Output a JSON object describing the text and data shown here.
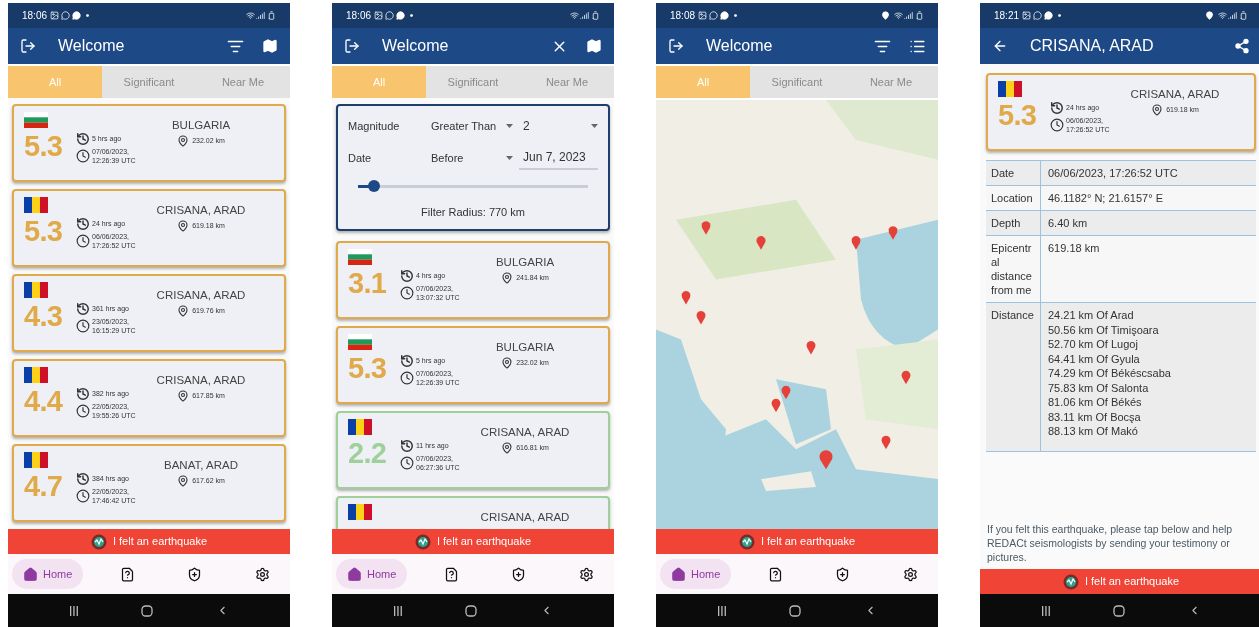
{
  "screens": [
    {
      "kind": "list",
      "status_bar": {
        "time": "18:06",
        "location": false
      },
      "app_bar": {
        "leading": {
          "kind": "logout"
        },
        "title": "Welcome",
        "actions": [
          {
            "kind": "filter"
          },
          {
            "kind": "map"
          }
        ]
      },
      "tabs": [
        {
          "label": "All",
          "selected": true
        },
        {
          "label": "Significant",
          "selected": false
        },
        {
          "label": "Near Me",
          "selected": false
        }
      ],
      "events": [
        {
          "flag": {
            "kind": "bulgaria"
          },
          "color": "#e0a94a",
          "magnitude": "5.3",
          "region": "BULGARIA",
          "ago": "5 hrs ago",
          "datetime": "07/06/2023, 12:26:39 UTC",
          "distance": "232.02 km"
        },
        {
          "flag": {
            "kind": "romania"
          },
          "color": "#e0a94a",
          "magnitude": "5.3",
          "region": "CRISANA, ARAD",
          "ago": "24 hrs ago",
          "datetime": "06/06/2023, 17:26:52 UTC",
          "distance": "619.18 km"
        },
        {
          "flag": {
            "kind": "romania"
          },
          "color": "#e0a94a",
          "magnitude": "4.3",
          "region": "CRISANA, ARAD",
          "ago": "361 hrs ago",
          "datetime": "23/05/2023, 16:15:29 UTC",
          "distance": "619.76 km"
        },
        {
          "flag": {
            "kind": "romania"
          },
          "color": "#e0a94a",
          "magnitude": "4.4",
          "region": "CRISANA, ARAD",
          "ago": "382 hrs ago",
          "datetime": "22/05/2023, 19:55:26 UTC",
          "distance": "617.85 km"
        },
        {
          "flag": {
            "kind": "romania"
          },
          "color": "#e0a94a",
          "magnitude": "4.7",
          "region": "BANAT, ARAD",
          "ago": "384 hrs ago",
          "datetime": "22/05/2023, 17:46:42 UTC",
          "distance": "617.62 km"
        }
      ],
      "felt_button": "I felt an earthquake",
      "nav": [
        {
          "kind": "home",
          "label": "Home",
          "selected": true
        },
        {
          "kind": "help",
          "selected": false
        },
        {
          "kind": "shield",
          "selected": false
        },
        {
          "kind": "settings",
          "selected": false
        }
      ]
    },
    {
      "kind": "list",
      "status_bar": {
        "time": "18:06",
        "location": false
      },
      "app_bar": {
        "leading": {
          "kind": "logout"
        },
        "title": "Welcome",
        "actions": [
          {
            "kind": "close"
          },
          {
            "kind": "map"
          }
        ]
      },
      "tabs": [
        {
          "label": "All",
          "selected": true
        },
        {
          "label": "Significant",
          "selected": false
        },
        {
          "label": "Near Me",
          "selected": false
        }
      ],
      "filter": {
        "magnitude_label": "Magnitude",
        "magnitude_operator": "Greater Than",
        "magnitude_value": "2",
        "date_label": "Date",
        "date_operator": "Before",
        "date_value": "Jun 7, 2023",
        "radius": {
          "level": 0.07
        },
        "radius_label": "Filter Radius: 770 km"
      },
      "events": [
        {
          "flag": {
            "kind": "bulgaria"
          },
          "color": "#e0a94a",
          "magnitude": "3.1",
          "region": "BULGARIA",
          "ago": "4 hrs ago",
          "datetime": "07/06/2023, 13:07:32 UTC",
          "distance": "241.84 km"
        },
        {
          "flag": {
            "kind": "bulgaria"
          },
          "color": "#e0a94a",
          "magnitude": "5.3",
          "region": "BULGARIA",
          "ago": "5 hrs ago",
          "datetime": "07/06/2023, 12:26:39 UTC",
          "distance": "232.02 km"
        },
        {
          "flag": {
            "kind": "romania"
          },
          "color": "#9fd09a",
          "magnitude": "2.2",
          "region": "CRISANA, ARAD",
          "ago": "11 hrs ago",
          "datetime": "07/06/2023, 06:27:36 UTC",
          "distance": "616.81 km"
        },
        {
          "flag": {
            "kind": "romania"
          },
          "color": "#9fd09a",
          "region": "CRISANA, ARAD"
        }
      ],
      "felt_button": "I felt an earthquake",
      "nav": [
        {
          "kind": "home",
          "label": "Home",
          "selected": true
        },
        {
          "kind": "help",
          "selected": false
        },
        {
          "kind": "shield",
          "selected": false
        },
        {
          "kind": "settings",
          "selected": false
        }
      ]
    },
    {
      "kind": "map",
      "status_bar": {
        "time": "18:08",
        "location": true
      },
      "app_bar": {
        "leading": {
          "kind": "logout"
        },
        "title": "Welcome",
        "actions": [
          {
            "kind": "filter"
          },
          {
            "kind": "list"
          }
        ]
      },
      "tabs": [
        {
          "label": "All",
          "selected": true
        },
        {
          "label": "Significant",
          "selected": false
        },
        {
          "label": "Near Me",
          "selected": false
        }
      ],
      "felt_button": "I felt an earthquake",
      "nav": [
        {
          "kind": "home",
          "label": "Home",
          "selected": true
        },
        {
          "kind": "help",
          "selected": false
        },
        {
          "kind": "shield",
          "selected": false
        },
        {
          "kind": "settings",
          "selected": false
        }
      ]
    },
    {
      "kind": "detail",
      "status_bar": {
        "time": "18:21",
        "location": true
      },
      "app_bar": {
        "leading": {
          "kind": "back"
        },
        "title": "CRISANA, ARAD",
        "actions": [
          {
            "kind": "share"
          }
        ]
      },
      "event": {
        "flag": {
          "kind": "romania"
        },
        "color": "#e0a94a",
        "magnitude": "5.3",
        "region": "CRISANA, ARAD",
        "ago": "24 hrs ago",
        "datetime": "06/06/2023, 17:26:52 UTC",
        "distance": "619.18 km"
      },
      "details": [
        {
          "label": "Date",
          "value": "06/06/2023, 17:26:52 UTC"
        },
        {
          "label": "Location",
          "value": "46.1182° N; 21.6157° E"
        },
        {
          "label": "Depth",
          "value": "6.40 km"
        },
        {
          "label": "Epicentral distance from me",
          "value": "619.18 km"
        },
        {
          "label": "Distance",
          "lines": [
            "24.21 km Of Arad",
            "50.56 km Of Timişoara",
            "52.70 km Of Lugoj",
            "64.41 km Of Gyula",
            "74.29 km Of Békéscsaba",
            "75.83 km Of Salonta",
            "81.06 km Of Békés",
            "83.11 km Of Bocşa",
            "88.13 km Of Makó"
          ]
        }
      ],
      "note": "If you felt this earthquake, please tap below and help REDACt seismologists by sending your testimony or pictures.",
      "felt_button": "I felt an earthquake"
    }
  ]
}
